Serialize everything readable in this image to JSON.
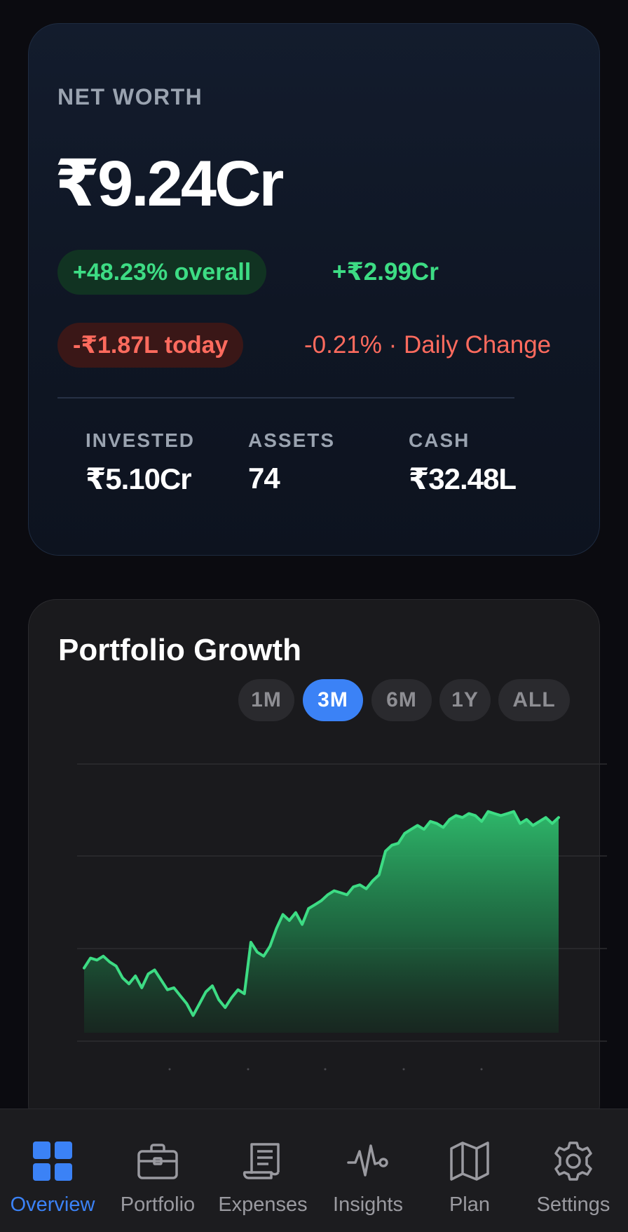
{
  "net_worth": {
    "label": "NET WORTH",
    "value": "₹9.24Cr",
    "overall_pill": "+48.23% overall",
    "overall_amount": "+₹2.99Cr",
    "today_pill": "-₹1.87L today",
    "daily_change": "-0.21% · Daily Change",
    "stats": [
      {
        "label": "INVESTED",
        "value": "₹5.10Cr"
      },
      {
        "label": "ASSETS",
        "value": "74"
      },
      {
        "label": "CASH",
        "value": "₹32.48L"
      }
    ]
  },
  "growth": {
    "title": "Portfolio Growth",
    "ranges": [
      "1M",
      "3M",
      "6M",
      "1Y",
      "ALL"
    ],
    "active_range": "3M"
  },
  "chart_data": {
    "type": "area",
    "title": "Portfolio Growth",
    "xlabel": "",
    "ylabel": "",
    "grid": true,
    "series": [
      {
        "color": "#3ddc84",
        "values": [
          0.32,
          0.37,
          0.36,
          0.38,
          0.35,
          0.33,
          0.27,
          0.24,
          0.28,
          0.22,
          0.29,
          0.31,
          0.26,
          0.21,
          0.22,
          0.18,
          0.14,
          0.08,
          0.14,
          0.2,
          0.23,
          0.16,
          0.12,
          0.17,
          0.21,
          0.19,
          0.45,
          0.4,
          0.38,
          0.43,
          0.52,
          0.59,
          0.56,
          0.6,
          0.54,
          0.62,
          0.64,
          0.66,
          0.69,
          0.71,
          0.7,
          0.69,
          0.73,
          0.74,
          0.72,
          0.76,
          0.79,
          0.91,
          0.94,
          0.95,
          1.0,
          1.02,
          1.04,
          1.02,
          1.06,
          1.05,
          1.03,
          1.07,
          1.09,
          1.08,
          1.1,
          1.09,
          1.06,
          1.11,
          1.1,
          1.09,
          1.1,
          1.11,
          1.05,
          1.07,
          1.04,
          1.06,
          1.08,
          1.05,
          1.08
        ]
      }
    ]
  },
  "nav": {
    "items": [
      {
        "label": "Overview",
        "icon": "grid-icon",
        "active": true
      },
      {
        "label": "Portfolio",
        "icon": "briefcase-icon",
        "active": false
      },
      {
        "label": "Expenses",
        "icon": "receipt-icon",
        "active": false
      },
      {
        "label": "Insights",
        "icon": "pulse-icon",
        "active": false
      },
      {
        "label": "Plan",
        "icon": "map-icon",
        "active": false
      },
      {
        "label": "Settings",
        "icon": "gear-icon",
        "active": false
      }
    ],
    "accent": "#3b82f6",
    "inactive": "#9a9aa0"
  },
  "colors": {
    "positive": "#3ddc84",
    "negative": "#ff6b5e",
    "accent": "#3b82f6"
  }
}
